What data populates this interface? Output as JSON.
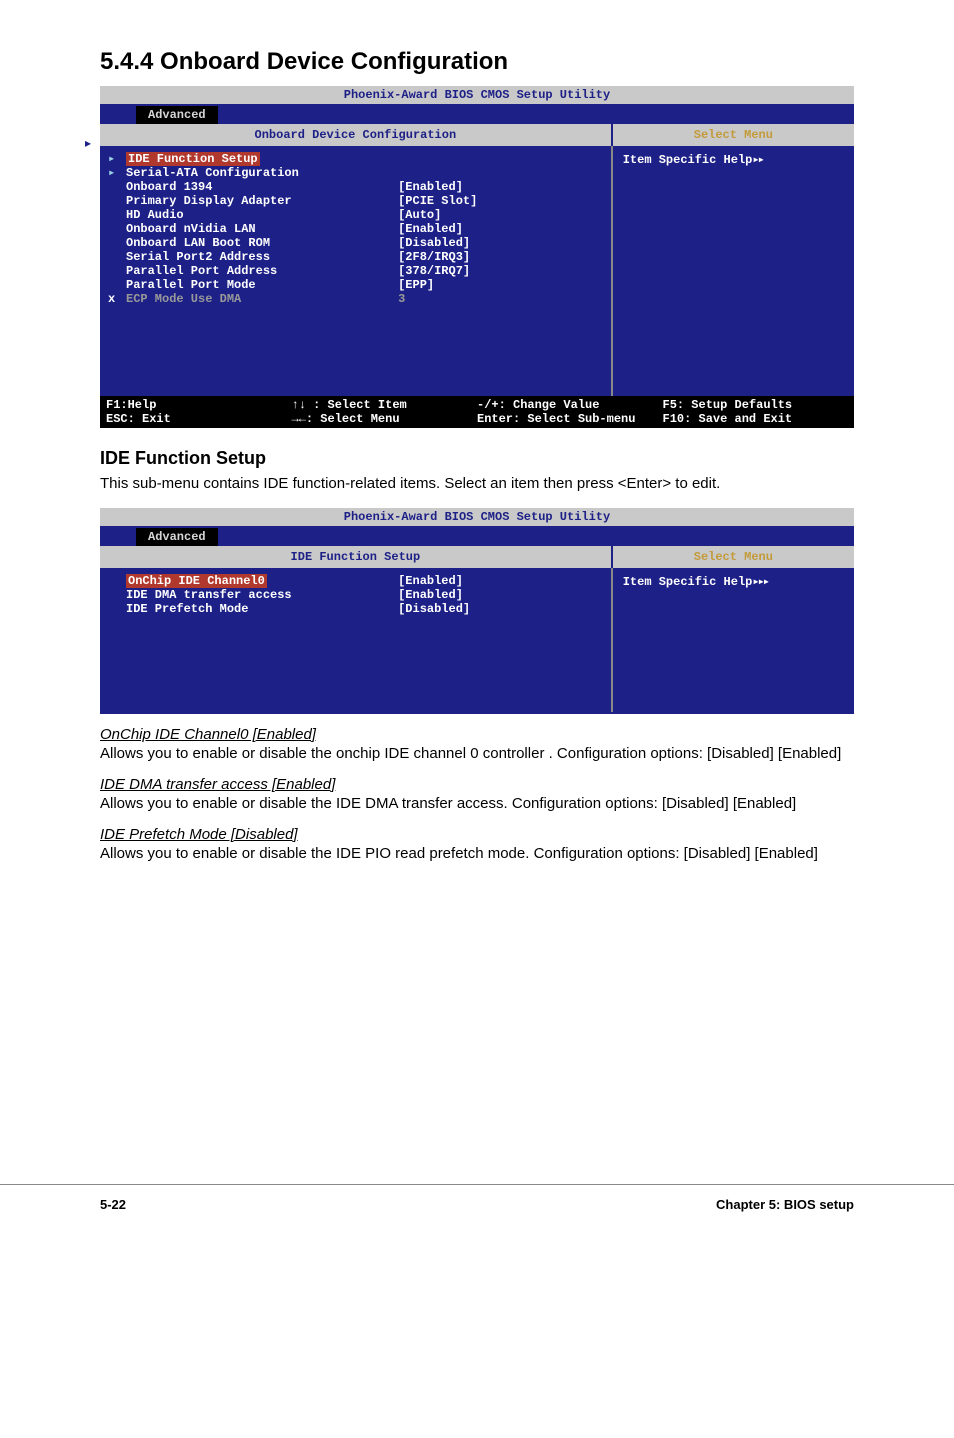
{
  "section": {
    "title": "5.4.4   Onboard Device Configuration"
  },
  "bios1": {
    "title": "Phoenix-Award BIOS CMOS Setup Utility",
    "tab": "Advanced",
    "panel_title": "Onboard Device Configuration",
    "select_menu": "Select Menu",
    "help_label": "Item Specific Help",
    "rows": [
      {
        "mark": "▸",
        "label": "IDE Function Setup",
        "value": "",
        "hl": true
      },
      {
        "mark": "▸",
        "label": "Serial-ATA Configuration",
        "value": ""
      },
      {
        "mark": "",
        "label": "Onboard 1394",
        "value": "[Enabled]"
      },
      {
        "mark": "",
        "label": "Primary Display Adapter",
        "value": "[PCIE Slot]"
      },
      {
        "mark": "",
        "label": "HD Audio",
        "value": "[Auto]"
      },
      {
        "mark": "",
        "label": "Onboard nVidia LAN",
        "value": "[Enabled]"
      },
      {
        "mark": "",
        "label": "Onboard LAN Boot ROM",
        "value": "[Disabled]"
      },
      {
        "mark": "",
        "label": "Serial Port2 Address",
        "value": "[2F8/IRQ3]"
      },
      {
        "mark": "",
        "label": "Parallel Port Address",
        "value": "[378/IRQ7]"
      },
      {
        "mark": "",
        "label": "Parallel Port Mode",
        "value": "[EPP]"
      },
      {
        "mark": "x",
        "label": "ECP Mode Use DMA",
        "value": "3",
        "dim": true
      }
    ],
    "footer": {
      "c1a": "F1:Help",
      "c1b": "ESC: Exit",
      "c2a": "↑↓ : Select Item",
      "c2b": "→←: Select Menu",
      "c3a": "-/+: Change Value",
      "c3b": "Enter: Select Sub-menu",
      "c4a": "F5: Setup Defaults",
      "c4b": "F10: Save and Exit"
    }
  },
  "ide_heading": "IDE Function Setup",
  "ide_body": "This sub-menu contains IDE function-related items. Select an item then press <Enter> to edit.",
  "bios2": {
    "title": "Phoenix-Award BIOS CMOS Setup Utility",
    "tab": "Advanced",
    "panel_title": "IDE Function Setup",
    "select_menu": "Select Menu",
    "help_label": "Item Specific Help",
    "rows": [
      {
        "label": "OnChip IDE Channel0",
        "value": "[Enabled]",
        "hl": true
      },
      {
        "label": "IDE DMA transfer access",
        "value": "[Enabled]"
      },
      {
        "label": "IDE Prefetch Mode",
        "value": "[Disabled]"
      }
    ]
  },
  "paras": [
    {
      "title": "OnChip IDE Channel0 [Enabled]",
      "body": "Allows you to enable or disable the onchip IDE channel 0 controller . Configuration options: [Disabled] [Enabled]"
    },
    {
      "title": "IDE DMA transfer access [Enabled]",
      "body": "Allows you to enable or disable the IDE DMA transfer access. Configuration options: [Disabled] [Enabled]"
    },
    {
      "title": "IDE Prefetch Mode [Disabled]",
      "body": "Allows you to enable or disable the IDE PIO read prefetch mode. Configuration options: [Disabled] [Enabled]"
    }
  ],
  "footer": {
    "page": "5-22",
    "chapter": "Chapter 5: BIOS setup"
  }
}
